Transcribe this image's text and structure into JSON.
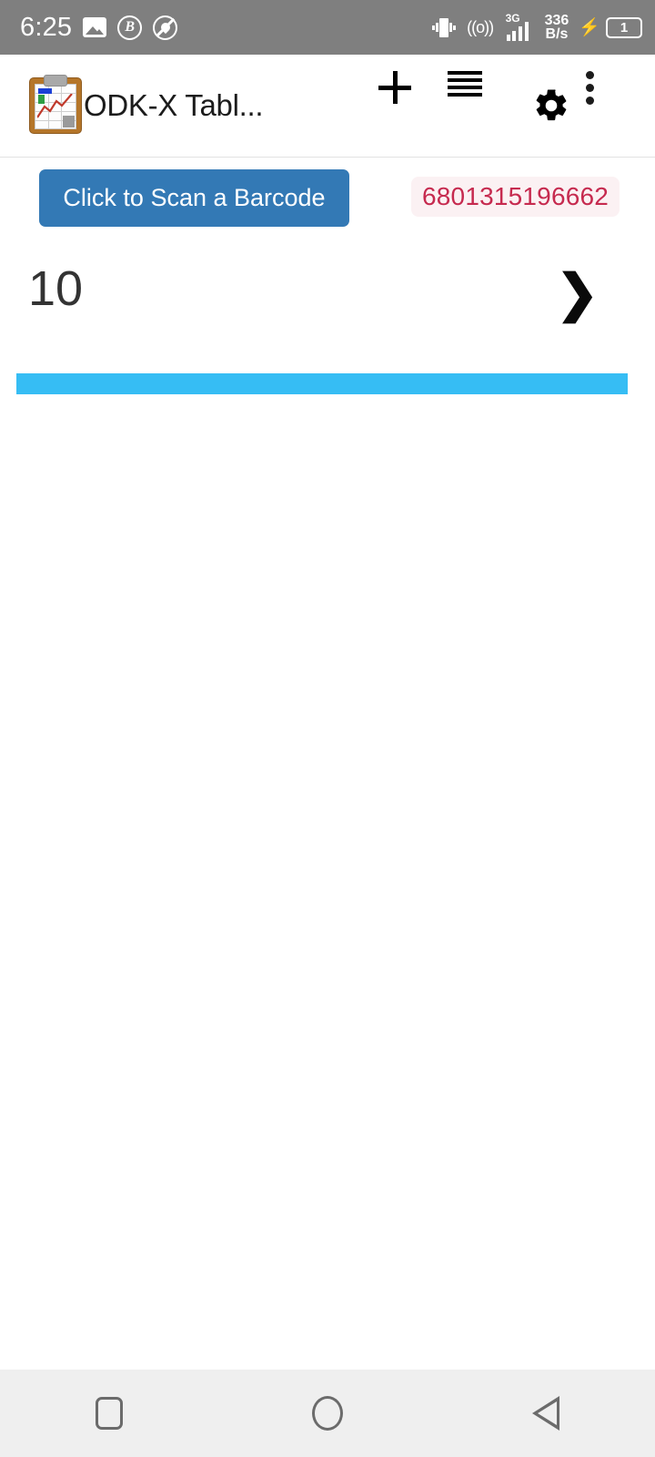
{
  "status_bar": {
    "time": "6:25",
    "background_color": "#7f7f7f",
    "left_icons": [
      {
        "name": "photo-icon",
        "label": "photo"
      },
      {
        "name": "bitwarden-icon",
        "label": "B"
      },
      {
        "name": "do-not-disturb-icon",
        "label": "dnd"
      }
    ],
    "right_icons": [
      {
        "name": "vibrate-icon",
        "label": "vibrate"
      },
      {
        "name": "hotspot-icon",
        "label": "((o))"
      }
    ],
    "network": {
      "type": "3G",
      "rate_value": "336",
      "rate_unit": "B/s"
    },
    "battery": {
      "level_label": "1",
      "charging_glyph": "⚡"
    }
  },
  "app_bar": {
    "logo_name": "odkx-tables-logo",
    "title": "ODK-X Tabl...",
    "actions": [
      {
        "name": "add-button",
        "icon": "plus-icon",
        "label": "+"
      },
      {
        "name": "menu-button",
        "icon": "hamburger-icon",
        "label": "Menu"
      },
      {
        "name": "settings-button",
        "icon": "gear-icon",
        "label": "Settings"
      },
      {
        "name": "overflow-button",
        "icon": "more-vertical-icon",
        "label": "More options"
      }
    ]
  },
  "content": {
    "scan_button_label": "Click to Scan a Barcode",
    "barcode_value": "6801315196662",
    "barcode_text_color": "#c62a4f",
    "barcode_bg_color": "#fbf1f3",
    "count_value": "10",
    "chevron_glyph": "❯",
    "progress_bar_color": "#36bdf4",
    "button_color": "#3379b5"
  },
  "nav_bar": {
    "buttons": [
      {
        "name": "recents-button",
        "label": "Recents"
      },
      {
        "name": "home-button",
        "label": "Home"
      },
      {
        "name": "back-button",
        "label": "Back"
      }
    ]
  }
}
